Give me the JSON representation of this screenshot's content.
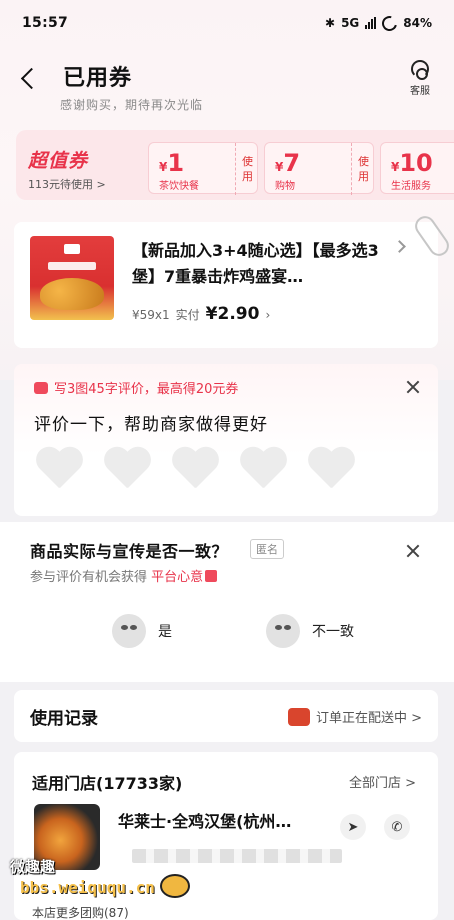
{
  "status_bar": {
    "time": "15:57",
    "network": "5G",
    "battery": "84%"
  },
  "header": {
    "title": "已用券",
    "subtitle": "感谢购买，期待再次光临",
    "service_label": "客服"
  },
  "coupon_bar": {
    "brand": "超值券",
    "available": "113元待使用 >",
    "coupons": [
      {
        "currency": "¥",
        "amount": "1",
        "label": "茶饮快餐",
        "action": "使用"
      },
      {
        "currency": "¥",
        "amount": "7",
        "label": "购物",
        "action": "使用"
      },
      {
        "currency": "¥",
        "amount": "10",
        "label": "生活服务",
        "action": ""
      }
    ]
  },
  "order": {
    "name": "【新品加入3+4随心选】【最多选3堡】7重暴击炸鸡盛宴…",
    "unit_price": "¥59x1",
    "paid_label": "实付",
    "paid_amount": "¥2.90"
  },
  "review": {
    "prompt": "写3图45字评价，最高得20元券",
    "ask": "评价一下，帮助商家做得更好"
  },
  "survey": {
    "question": "商品实际与宣传是否一致？",
    "anon_tag": "匿名",
    "hint": "参与评价有机会获得",
    "hint_highlight": "平台心意",
    "yes_label": "是",
    "no_label": "不一致"
  },
  "usage": {
    "title": "使用记录",
    "delivery": "订单正在配送中 >"
  },
  "stores": {
    "title": "适用门店(17733家)",
    "all_label": "全部门店 >",
    "store_name": "华莱士·全鸡汉堡(杭州…",
    "more_label": "本店更多团购(87)"
  },
  "watermark": {
    "line1": "微趣趣",
    "line2": "bbs.weiququ.cn"
  },
  "colors": {
    "accent": "#e8334a",
    "page_bg": "#f2f1f4"
  }
}
